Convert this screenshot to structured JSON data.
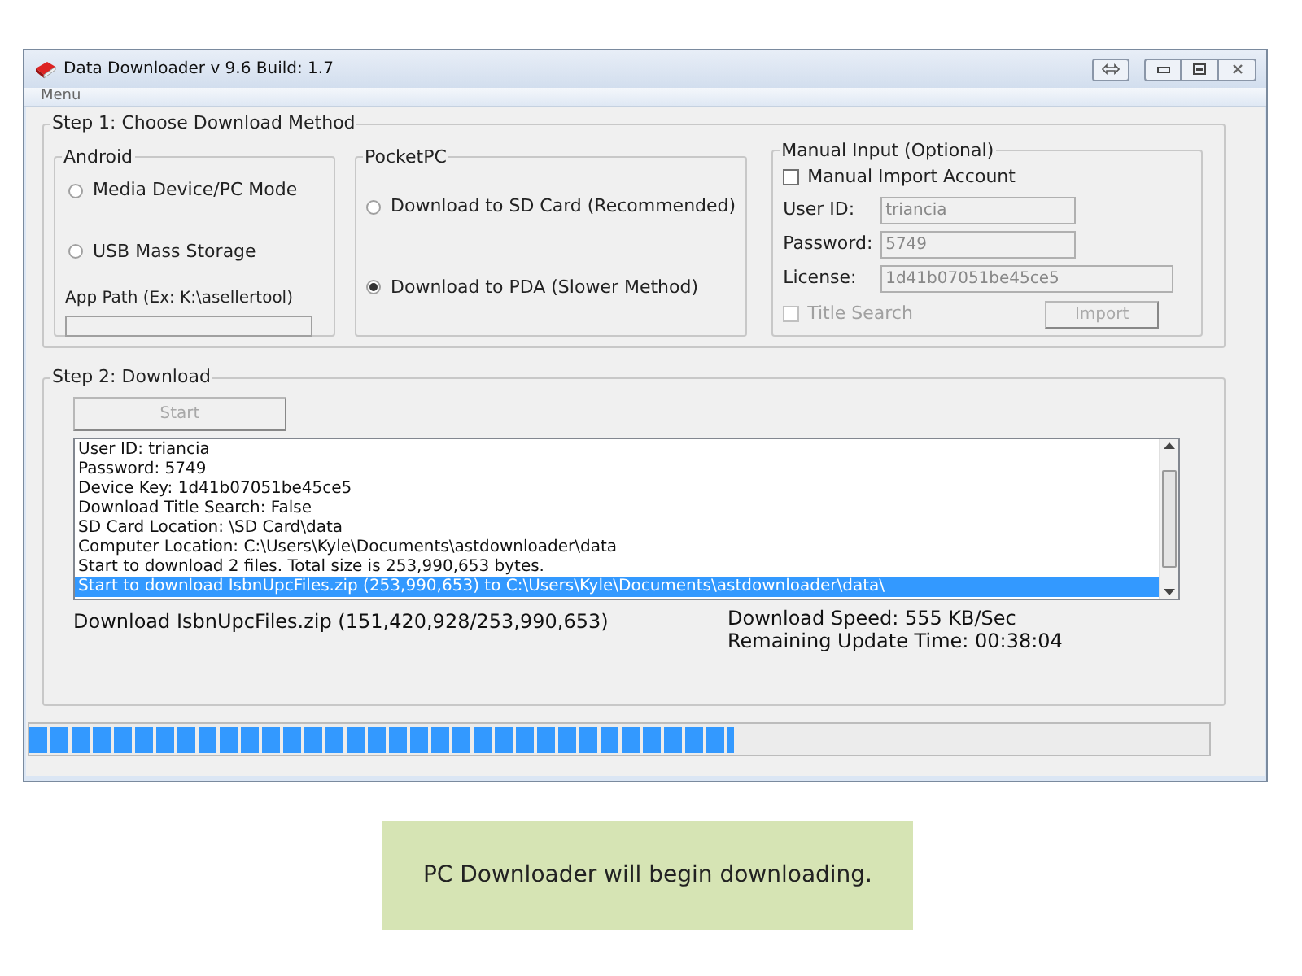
{
  "window": {
    "title": "Data Downloader v 9.6 Build: 1.7"
  },
  "menu": [
    "Menu"
  ],
  "step1": {
    "title": "Step 1: Choose Download Method",
    "android": {
      "title": "Android",
      "options": [
        {
          "label": "Media Device/PC Mode",
          "selected": false
        },
        {
          "label": "USB Mass Storage",
          "selected": false
        }
      ],
      "app_path": {
        "label": "App Path (Ex: K:\\asellertool)"
      }
    },
    "pocketpc": {
      "title": "PocketPC",
      "options": [
        {
          "label": "Download to SD Card (Recommended)",
          "selected": false
        },
        {
          "label": "Download to PDA (Slower Method)",
          "selected": true
        }
      ]
    },
    "manual": {
      "title": "Manual Input (Optional)",
      "account": {
        "label": "Manual Import Account",
        "checked": false,
        "disabled": false
      },
      "fields": [
        {
          "label": "User ID:",
          "value": "triancia"
        },
        {
          "label": "Password:",
          "value": "5749"
        },
        {
          "label": "License:",
          "value": "1d41b07051be45ce5"
        }
      ],
      "title_search": {
        "label": "Title Search",
        "checked": false,
        "disabled": true
      },
      "import_button": {
        "label": "Import",
        "disabled": true
      }
    }
  },
  "step2": {
    "title": "Step 2: Download",
    "start_button": {
      "label": "Start",
      "disabled": true
    },
    "log": [
      {
        "text": "User ID: triancia",
        "selected": false
      },
      {
        "text": "Password: 5749",
        "selected": false
      },
      {
        "text": "Device Key: 1d41b07051be45ce5",
        "selected": false
      },
      {
        "text": "Download Title Search: False",
        "selected": false
      },
      {
        "text": "SD Card Location: \\SD Card\\data",
        "selected": false
      },
      {
        "text": "Computer Location: C:\\Users\\Kyle\\Documents\\astdownloader\\data",
        "selected": false
      },
      {
        "text": "Start to download 2 files. Total size is 253,990,653 bytes.",
        "selected": false
      },
      {
        "text": "Start to download IsbnUpcFiles.zip (253,990,653) to C:\\Users\\Kyle\\Documents\\astdownloader\\data\\",
        "selected": true
      }
    ],
    "file_status": "Download IsbnUpcFiles.zip (151,420,928/253,990,653)",
    "speed": "Download Speed: 555 KB/Sec",
    "remaining": "Remaining Update Time: 00:38:04"
  },
  "progress": {
    "level": 0.6
  },
  "caption": "PC Downloader will begin downloading."
}
